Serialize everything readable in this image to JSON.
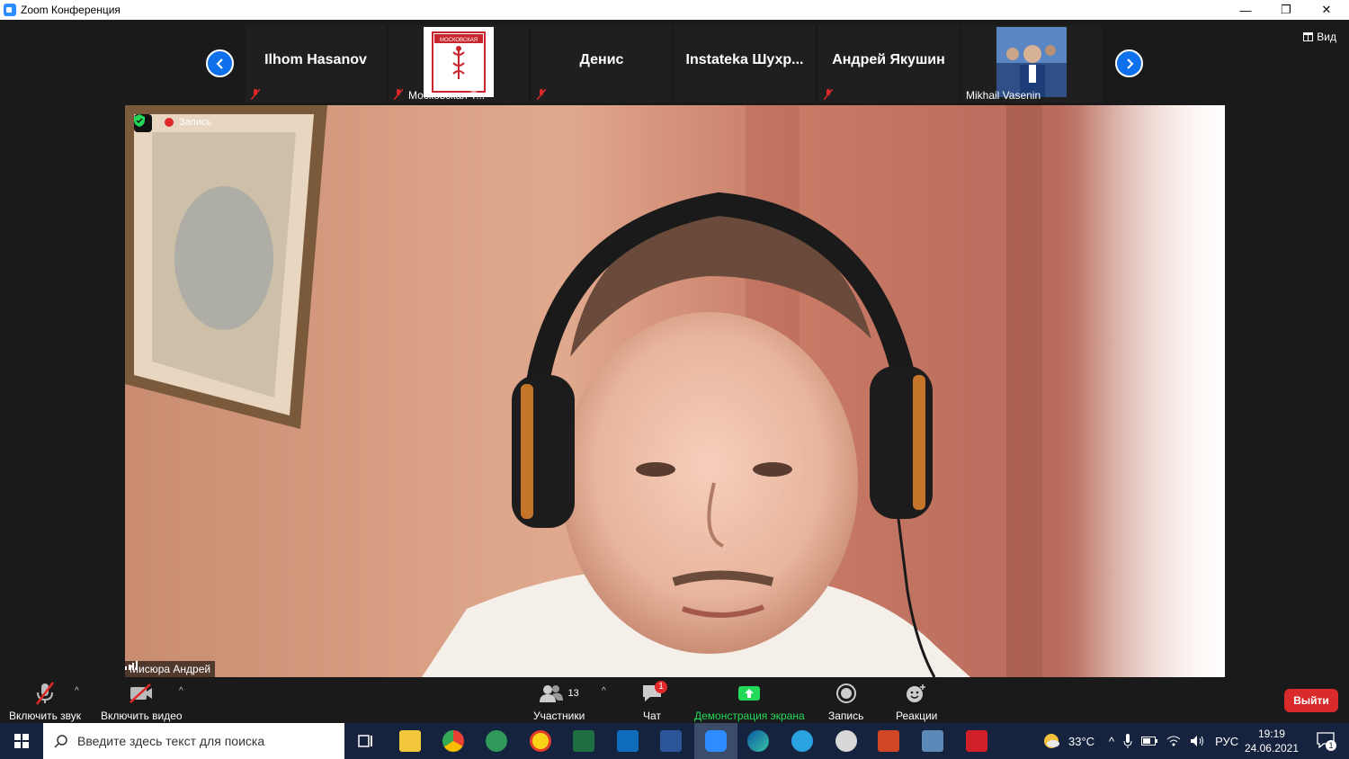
{
  "window": {
    "title": "Zoom Конференция",
    "minimize": "—",
    "restore": "❐",
    "close": "✕"
  },
  "strip": {
    "view_label": "Вид",
    "tiles": [
      {
        "name": "Ilhom Hasanov",
        "footer": ""
      },
      {
        "name": "",
        "footer": "Московская Т..."
      },
      {
        "name": "Денис",
        "footer": ""
      },
      {
        "name": "Instateka  Шухр...",
        "footer": ""
      },
      {
        "name": "Андрей Якушин",
        "footer": ""
      },
      {
        "name": "",
        "footer": "Mikhail Vasenin"
      }
    ],
    "logo_text": "МОСКОВСКАЯ"
  },
  "video": {
    "recording_label": "Запись",
    "speaker_name": "Мисюра Андрей"
  },
  "toolbar": {
    "audio_label": "Включить звук",
    "video_label": "Включить видео",
    "participants_label": "Участники",
    "participants_count": "13",
    "chat_label": "Чат",
    "chat_badge": "1",
    "share_label": "Демонстрация экрана",
    "record_label": "Запись",
    "reactions_label": "Реакции",
    "leave_label": "Выйти"
  },
  "taskbar": {
    "search_placeholder": "Введите здесь текст для поиска",
    "temperature": "33°C",
    "language": "РУС",
    "time": "19:19",
    "date": "24.06.2021",
    "notification_count": "1"
  },
  "colors": {
    "accent": "#0e71eb",
    "share_green": "#23d959",
    "leave_red": "#d92b2b",
    "taskbar": "#16233e"
  }
}
